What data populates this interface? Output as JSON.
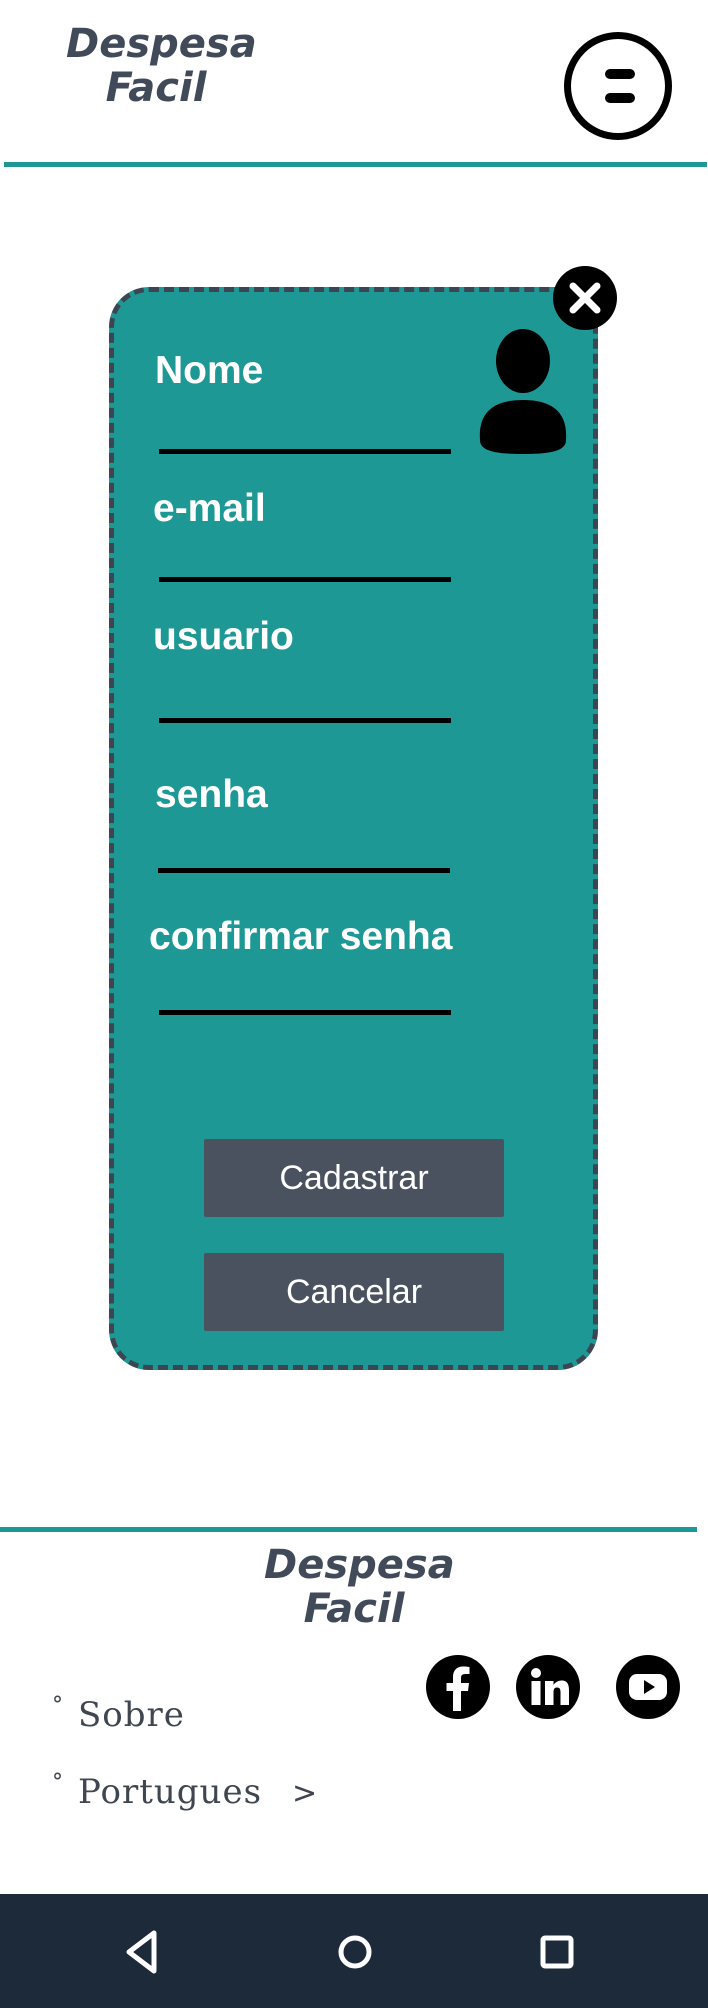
{
  "header": {
    "logo_line1": "Despesa",
    "logo_line2": "Facil",
    "menu_icon": "menu-circle-icon"
  },
  "modal": {
    "close_icon": "close-icon",
    "avatar_icon": "user-avatar-icon",
    "fields": [
      {
        "label": "Nome",
        "value": ""
      },
      {
        "label": "e-mail",
        "value": ""
      },
      {
        "label": "usuario",
        "value": ""
      },
      {
        "label": "senha",
        "value": ""
      },
      {
        "label": "confirmar senha",
        "value": ""
      }
    ],
    "primary_button": "Cadastrar",
    "secondary_button": "Cancelar",
    "colors": {
      "panel": "#1d9894",
      "border": "#3c4552",
      "button": "#4a525f"
    }
  },
  "footer": {
    "logo_line1": "Despesa",
    "logo_line2": "Facil",
    "links": [
      {
        "bullet": "°",
        "label": "Sobre"
      },
      {
        "bullet": "°",
        "label": "Portugues",
        "chevron": ">"
      }
    ],
    "social": [
      "facebook-icon",
      "linkedin-icon",
      "youtube-icon"
    ]
  },
  "navbar": {
    "keys": [
      "back-icon",
      "home-icon",
      "recents-icon"
    ]
  }
}
